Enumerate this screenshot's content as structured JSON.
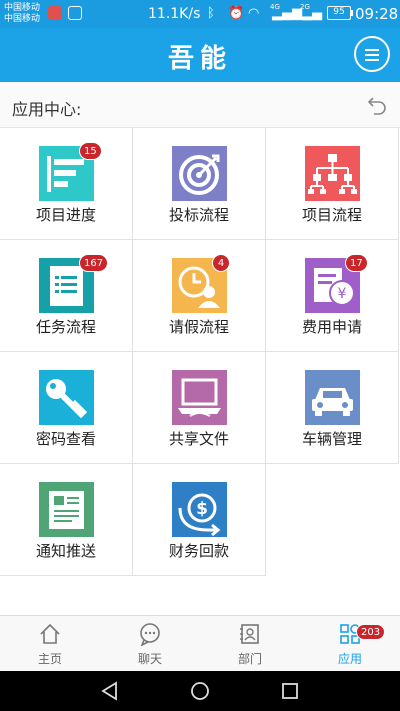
{
  "status_bar": {
    "carrier_1": "中国移动",
    "carrier_2": "中国移动",
    "net_speed": "11.1K/s",
    "net_4g": "4G",
    "net_2g": "2G",
    "battery": "95",
    "time": "09:28"
  },
  "header": {
    "brand": "吾能"
  },
  "section": {
    "title": "应用中心:"
  },
  "apps": [
    {
      "label": "项目进度",
      "icon": "progress-icon",
      "color": "#2ec8c9",
      "badge": "15"
    },
    {
      "label": "投标流程",
      "icon": "target-icon",
      "color": "#7d80c6",
      "badge": ""
    },
    {
      "label": "项目流程",
      "icon": "org-chart-icon",
      "color": "#f0595c",
      "badge": ""
    },
    {
      "label": "任务流程",
      "icon": "task-list-icon",
      "color": "#16a0a8",
      "badge": "167"
    },
    {
      "label": "请假流程",
      "icon": "leave-clock-icon",
      "color": "#f6b64e",
      "badge": "4"
    },
    {
      "label": "费用申请",
      "icon": "expense-yen-icon",
      "color": "#a05ec8",
      "badge": "17"
    },
    {
      "label": "密码查看",
      "icon": "key-icon",
      "color": "#1ab0d8",
      "badge": ""
    },
    {
      "label": "共享文件",
      "icon": "laptop-share-icon",
      "color": "#b46aa8",
      "badge": ""
    },
    {
      "label": "车辆管理",
      "icon": "car-icon",
      "color": "#6a8fc8",
      "badge": ""
    },
    {
      "label": "通知推送",
      "icon": "notice-icon",
      "color": "#4fa576",
      "badge": ""
    },
    {
      "label": "财务回款",
      "icon": "dollar-return-icon",
      "color": "#2e7fc6",
      "badge": ""
    }
  ],
  "bottom_nav": [
    {
      "label": "主页",
      "icon": "home-icon"
    },
    {
      "label": "聊天",
      "icon": "chat-icon"
    },
    {
      "label": "部门",
      "icon": "department-icon"
    },
    {
      "label": "应用",
      "icon": "apps-icon",
      "badge": "203",
      "active": true
    }
  ],
  "colors": {
    "accent": "#1ca2e6",
    "badge": "#c9262c"
  }
}
